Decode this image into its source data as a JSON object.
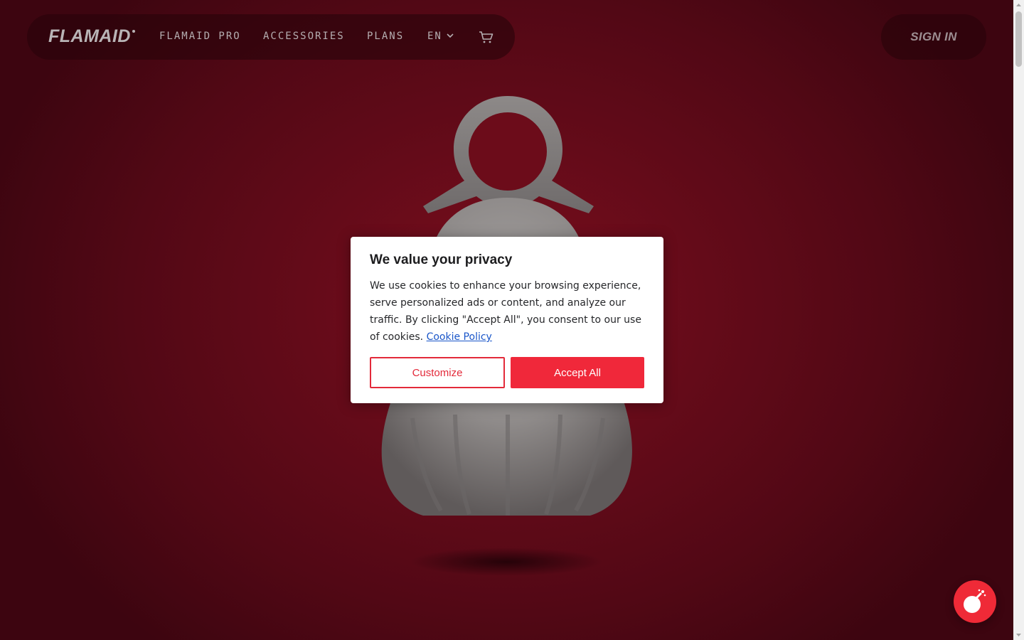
{
  "nav": {
    "logo": "FLAMAID",
    "links": [
      {
        "label": "FLAMAID PRO"
      },
      {
        "label": "ACCESSORIES"
      },
      {
        "label": "PLANS"
      }
    ],
    "language": "EN",
    "cart_icon": "cart-icon",
    "sign_in": "SIGN IN"
  },
  "cookie_dialog": {
    "title": "We value your privacy",
    "body": "We use cookies to enhance your browsing experience, serve personalized ads or content, and analyze our traffic. By clicking \"Accept All\", you consent to our use of cookies.",
    "policy_link": "Cookie Policy",
    "customize_label": "Customize",
    "accept_label": "Accept All"
  },
  "colors": {
    "background": "#640b19",
    "accent": "#f0283a",
    "link": "#1a56c9"
  },
  "chat_button": {
    "icon": "chat-bomb-icon"
  }
}
